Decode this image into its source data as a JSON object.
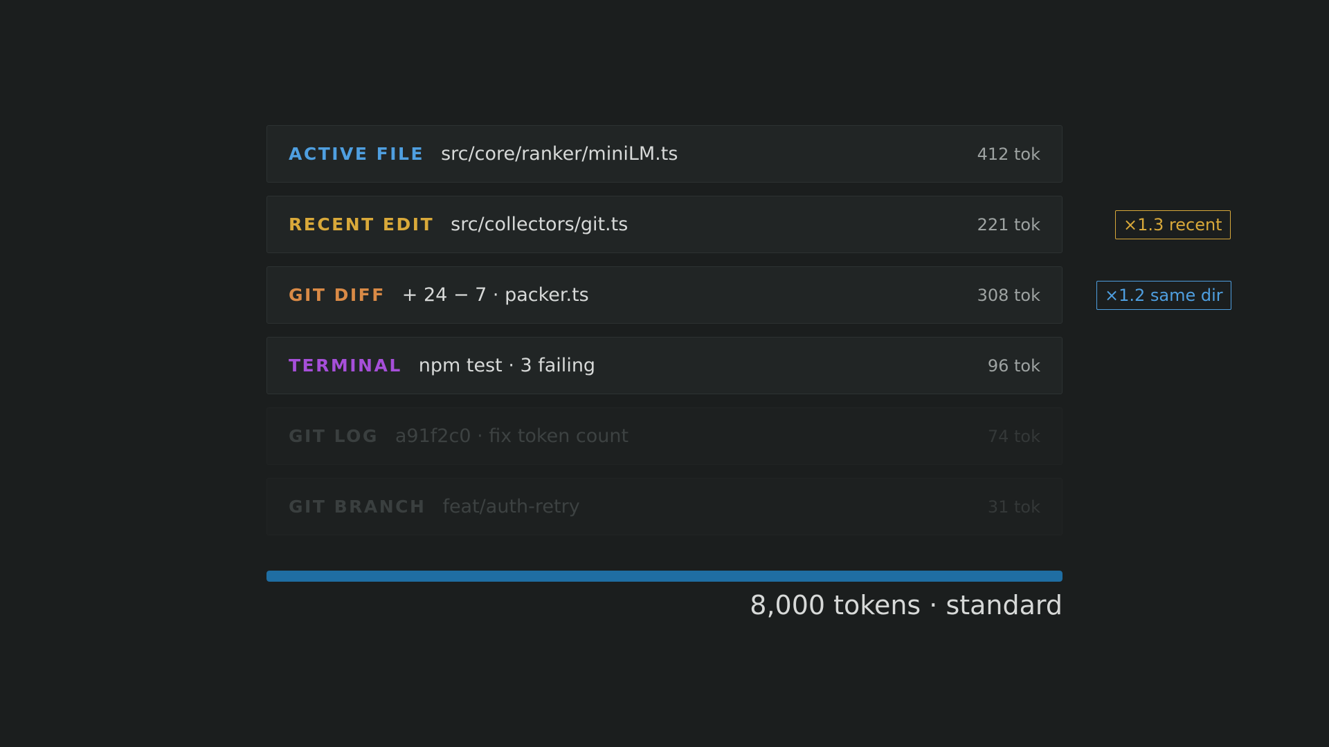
{
  "colors": {
    "active_file": "#4f9fe0",
    "recent_edit": "#d9a93a",
    "git_diff": "#d98a46",
    "terminal": "#a64fd9",
    "git_log": "#3a3f3f",
    "git_branch": "#3a3f3f",
    "boost_recent": "#d9a93a",
    "boost_same_dir": "#4f9fe0",
    "budget_fill": "#1f6ea3"
  },
  "context_items": [
    {
      "tag": "ACTIVE FILE",
      "desc": "src/core/ranker/miniLM.ts",
      "tokens": "412 tok"
    },
    {
      "tag": "RECENT EDIT",
      "desc": "src/collectors/git.ts",
      "tokens": "221 tok"
    },
    {
      "tag": "GIT DIFF",
      "desc": "+ 24 − 7 · packer.ts",
      "tokens": "308 tok"
    },
    {
      "tag": "TERMINAL",
      "desc": "npm test · 3 failing",
      "tokens": "96 tok"
    },
    {
      "tag": "GIT LOG",
      "desc": "a91f2c0 · fix token count",
      "tokens": "74 tok"
    },
    {
      "tag": "GIT BRANCH",
      "desc": "feat/auth-retry",
      "tokens": "31 tok"
    }
  ],
  "boosts": {
    "recent": "×1.3 recent",
    "same_dir": "×1.2 same dir"
  },
  "budget": {
    "label": "8,000 tokens · standard",
    "fill_fraction": 1.0
  }
}
